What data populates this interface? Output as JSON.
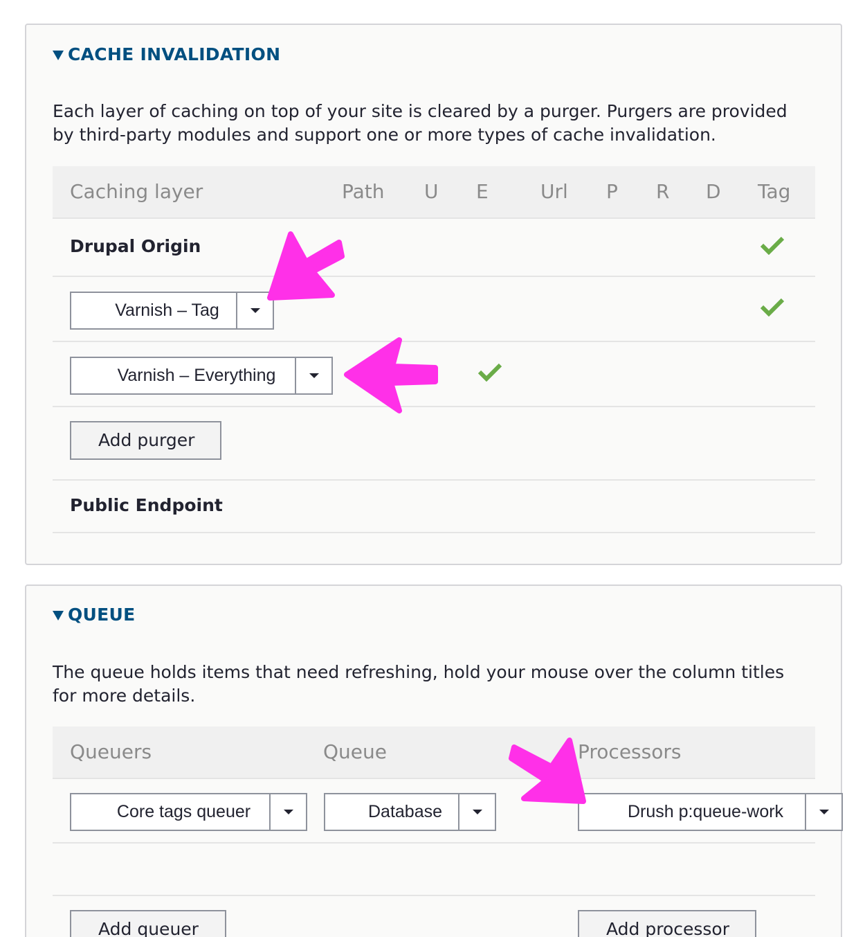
{
  "cache": {
    "title": "CACHE INVALIDATION",
    "description": "Each layer of caching on top of your site is cleared by a purger. Purgers are provided by third-party modules and support one or more types of cache invalidation.",
    "columns": [
      "Caching layer",
      "Path",
      "U",
      "E",
      "Url",
      "P",
      "R",
      "D",
      "Tag"
    ],
    "rows": {
      "drupal_origin": "Drupal Origin",
      "varnish_tag": "Varnish – Tag",
      "varnish_everything": "Varnish – Everything",
      "add_purger": "Add purger",
      "public_endpoint": "Public Endpoint"
    }
  },
  "queue": {
    "title": "QUEUE",
    "description": "The queue holds items that need refreshing, hold your mouse over the column titles for more details.",
    "columns": [
      "Queuers",
      "Queue",
      "Processors"
    ],
    "queuer": "Core tags queuer",
    "queue_backend": "Database",
    "processor": "Drush p:queue-work",
    "add_queuer": "Add queuer",
    "add_processor": "Add processor"
  },
  "colors": {
    "accent": "#004f80",
    "check": "#6aac48",
    "annotation": "#ff30e8"
  },
  "icons": {
    "check": "checkmark-icon",
    "dropdown": "caret-down-icon",
    "details": "triangle-down-icon",
    "annotation": "pink-arrow-annotation"
  }
}
